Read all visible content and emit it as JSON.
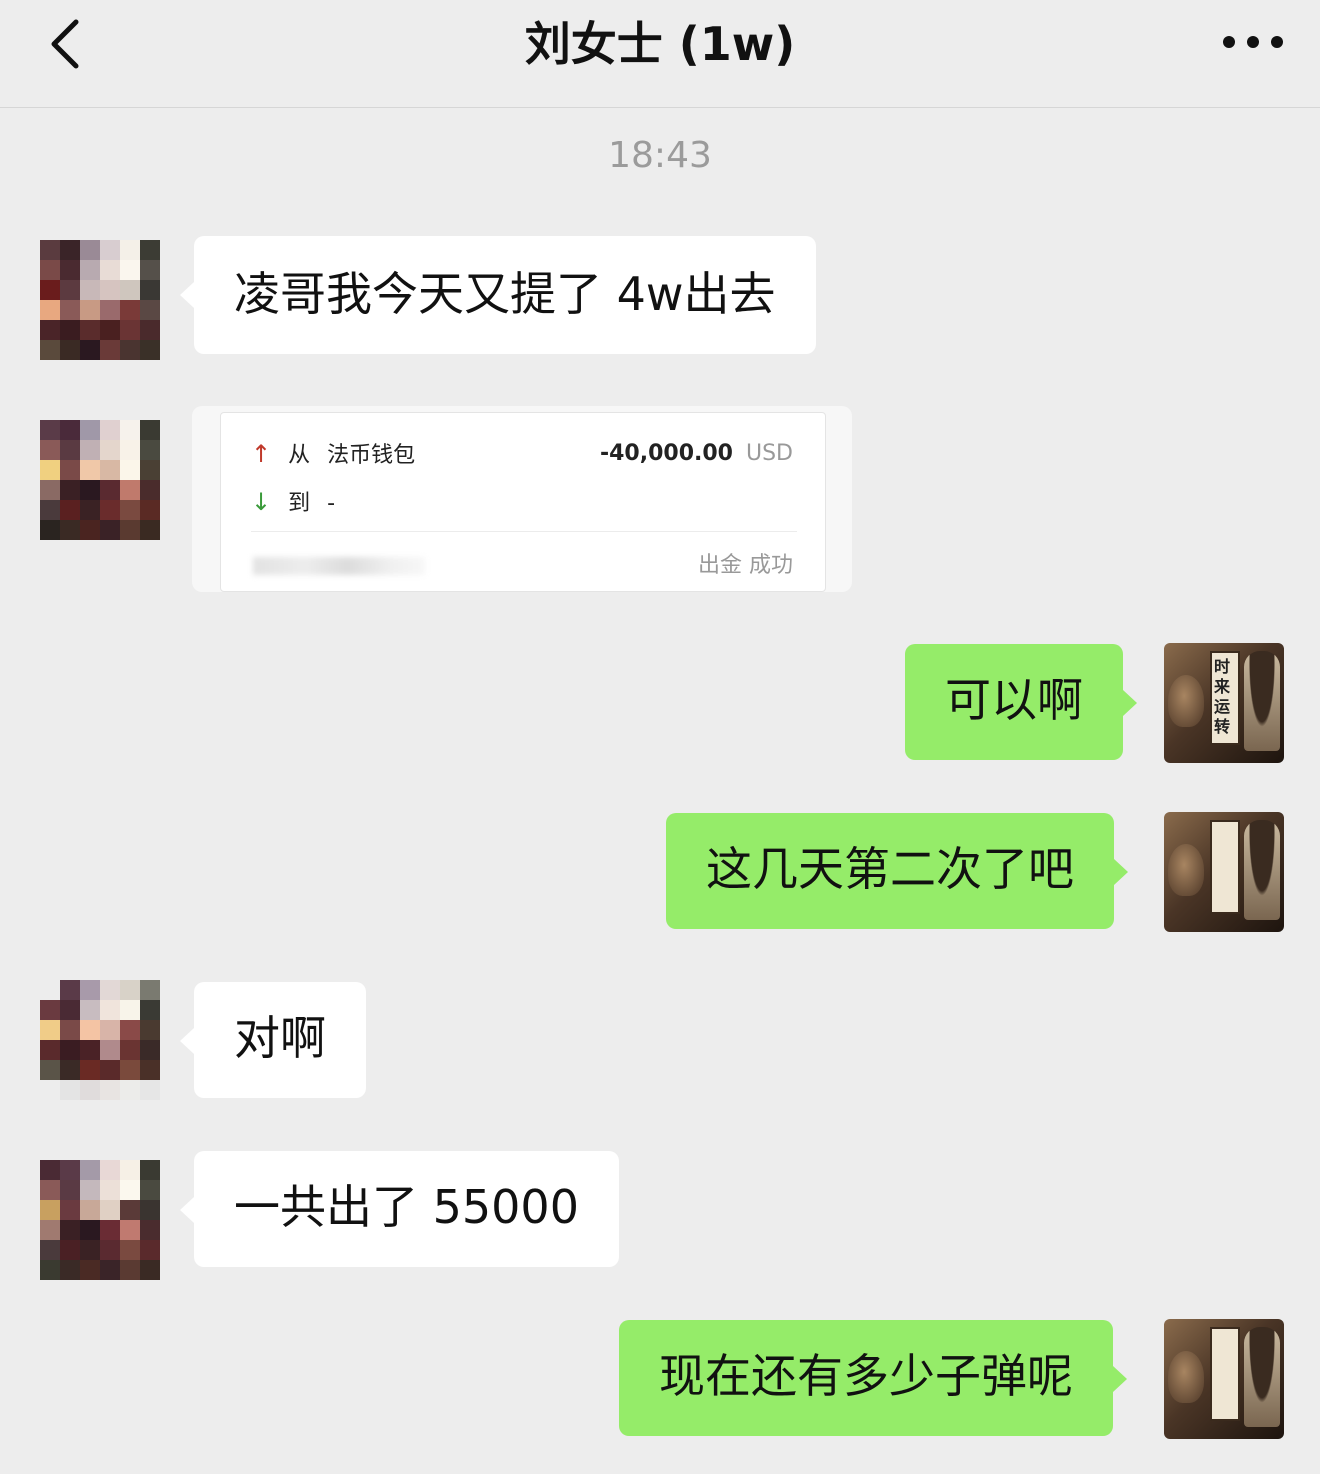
{
  "header": {
    "title": "刘女士 (1w)",
    "back_icon": "chevron-left-icon",
    "more_icon": "more-dots-icon"
  },
  "timestamp": "18:43",
  "messages": [
    {
      "from": "contact",
      "type": "text",
      "text": "凌哥我今天又提了 4w出去"
    },
    {
      "from": "contact",
      "type": "transaction",
      "transaction": {
        "from_label": "从",
        "from_value": "法币钱包",
        "to_label": "到",
        "to_value": "-",
        "amount": "-40,000.00",
        "currency": "USD",
        "status": "出金 成功"
      }
    },
    {
      "from": "me",
      "type": "text",
      "text": "可以啊"
    },
    {
      "from": "me",
      "type": "text",
      "text": "这几天第二次了吧"
    },
    {
      "from": "contact",
      "type": "text",
      "text": "对啊"
    },
    {
      "from": "contact",
      "type": "text",
      "text": "一共出了 55000"
    },
    {
      "from": "me",
      "type": "text",
      "text": "现在还有多少子弹呢"
    }
  ],
  "my_avatar": {
    "text": "时来运转"
  },
  "colors": {
    "background": "#ededed",
    "incoming_bubble": "#ffffff",
    "outgoing_bubble": "#95ec69",
    "amount_up_arrow": "#c0392b",
    "amount_down_arrow": "#3a9a3a"
  }
}
